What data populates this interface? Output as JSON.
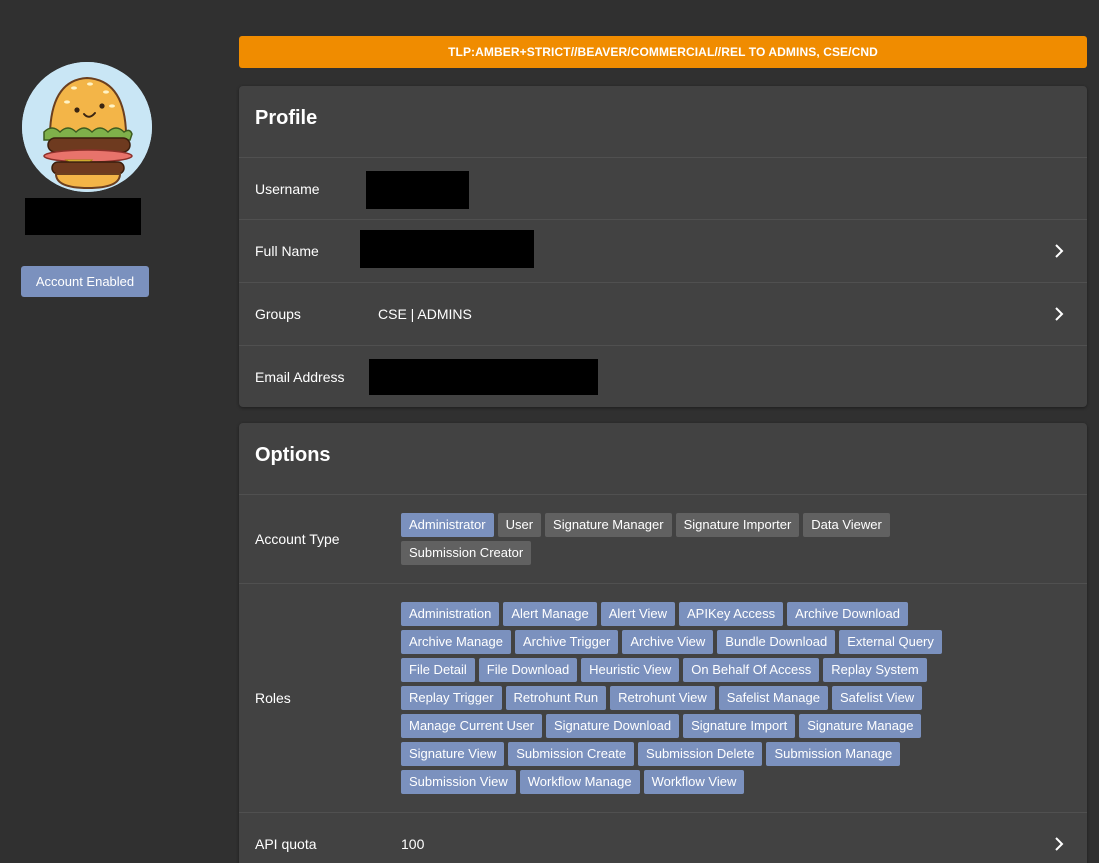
{
  "banner": {
    "text": "TLP:AMBER+STRICT//BEAVER/COMMERCIAL//REL TO ADMINS, CSE/CND",
    "color": "#f08c00"
  },
  "sidebar": {
    "avatar_icon": "burger-avatar",
    "account_status": "Account Enabled",
    "accent": "#7b91be"
  },
  "profile": {
    "title": "Profile",
    "username_label": "Username",
    "fullname_label": "Full Name",
    "groups_label": "Groups",
    "groups_value": "CSE | ADMINS",
    "email_label": "Email Address"
  },
  "options": {
    "title": "Options",
    "account_type_label": "Account Type",
    "account_types": [
      {
        "label": "Administrator",
        "active": true
      },
      {
        "label": "User",
        "active": false
      },
      {
        "label": "Signature Manager",
        "active": false
      },
      {
        "label": "Signature Importer",
        "active": false
      },
      {
        "label": "Data Viewer",
        "active": false
      },
      {
        "label": "Submission Creator",
        "active": false
      }
    ],
    "roles_label": "Roles",
    "roles": [
      "Administration",
      "Alert Manage",
      "Alert View",
      "APIKey Access",
      "Archive Download",
      "Archive Manage",
      "Archive Trigger",
      "Archive View",
      "Bundle Download",
      "External Query",
      "File Detail",
      "File Download",
      "Heuristic View",
      "On Behalf Of Access",
      "Replay System",
      "Replay Trigger",
      "Retrohunt Run",
      "Retrohunt View",
      "Safelist Manage",
      "Safelist View",
      "Manage Current User",
      "Signature Download",
      "Signature Import",
      "Signature Manage",
      "Signature View",
      "Submission Create",
      "Submission Delete",
      "Submission Manage",
      "Submission View",
      "Workflow Manage",
      "Workflow View"
    ],
    "api_quota_label": "API quota",
    "api_quota_value": "100"
  }
}
